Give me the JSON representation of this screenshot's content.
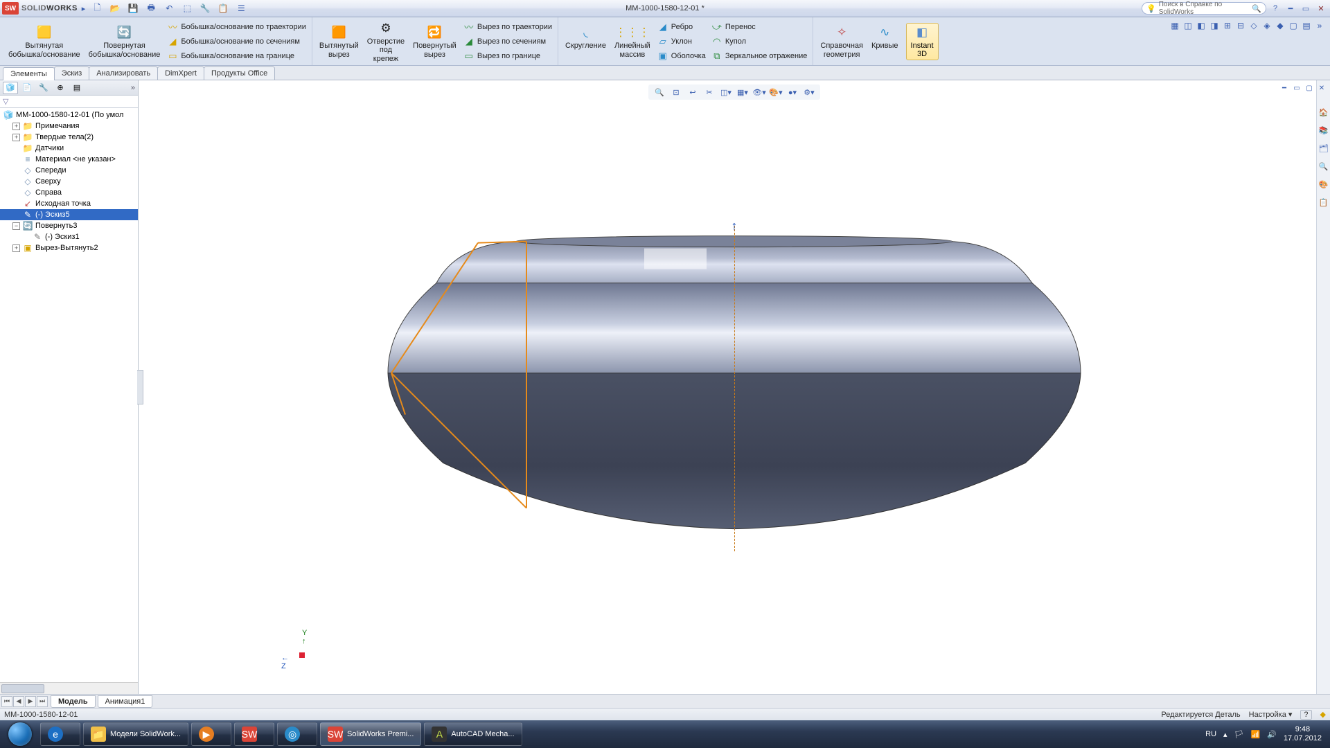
{
  "title": {
    "brand_thin": "SOLID",
    "brand_bold": "WORKS",
    "document": "MM-1000-1580-12-01 *"
  },
  "search": {
    "placeholder": "Поиск в Справке по SolidWorks"
  },
  "ribbon": {
    "g1": {
      "btn1_l1": "Вытянутая",
      "btn1_l2": "бобышка/основание",
      "btn2_l1": "Повернутая",
      "btn2_l2": "бобышка/основание"
    },
    "g1list": {
      "a": "Бобышка/основание по траектории",
      "b": "Бобышка/основание по сечениям",
      "c": "Бобышка/основание на границе"
    },
    "g2": {
      "btn1_l1": "Вытянутый",
      "btn1_l2": "вырез",
      "btn2_l1": "Отверстие",
      "btn2_l2": "под",
      "btn2_l3": "крепеж",
      "btn3_l1": "Повернутый",
      "btn3_l2": "вырез"
    },
    "g2list": {
      "a": "Вырез по траектории",
      "b": "Вырез по сечениям",
      "c": "Вырез по границе"
    },
    "g3": {
      "btn1": "Скругление",
      "btn2_l1": "Линейный",
      "btn2_l2": "массив"
    },
    "g3list": {
      "a": "Ребро",
      "b": "Уклон",
      "c": "Оболочка",
      "d": "Перенос",
      "e": "Купол",
      "f": "Зеркальное отражение"
    },
    "g4": {
      "btn1_l1": "Справочная",
      "btn1_l2": "геометрия",
      "btn2": "Кривые",
      "btn3_l1": "Instant",
      "btn3_l2": "3D"
    }
  },
  "cmtabs": {
    "t1": "Элементы",
    "t2": "Эскиз",
    "t3": "Анализировать",
    "t4": "DimXpert",
    "t5": "Продукты Office"
  },
  "tree": {
    "root": "MM-1000-1580-12-01  (По умол",
    "n1": "Примечания",
    "n2": "Твердые тела(2)",
    "n3": "Датчики",
    "n4": "Материал <не указан>",
    "n5": "Спереди",
    "n6": "Сверху",
    "n7": "Справа",
    "n8": "Исходная точка",
    "n9": "(-) Эскиз5",
    "n10": "Повернуть3",
    "n11": "(-) Эскиз1",
    "n12": "Вырез-Вытянуть2"
  },
  "triad": {
    "y": "Y",
    "z": "Z"
  },
  "modeltabs": {
    "t1": "Модель",
    "t2": "Анимация1"
  },
  "status": {
    "left": "MM-1000-1580-12-01",
    "mid": "Редактируется Деталь",
    "right": "Настройка"
  },
  "taskbar": {
    "t1": "Модели SolidWork...",
    "t2": "SolidWorks Premi...",
    "t3": "AutoCAD Mecha...",
    "lang": "RU",
    "time": "9:48",
    "date": "17.07.2012"
  }
}
